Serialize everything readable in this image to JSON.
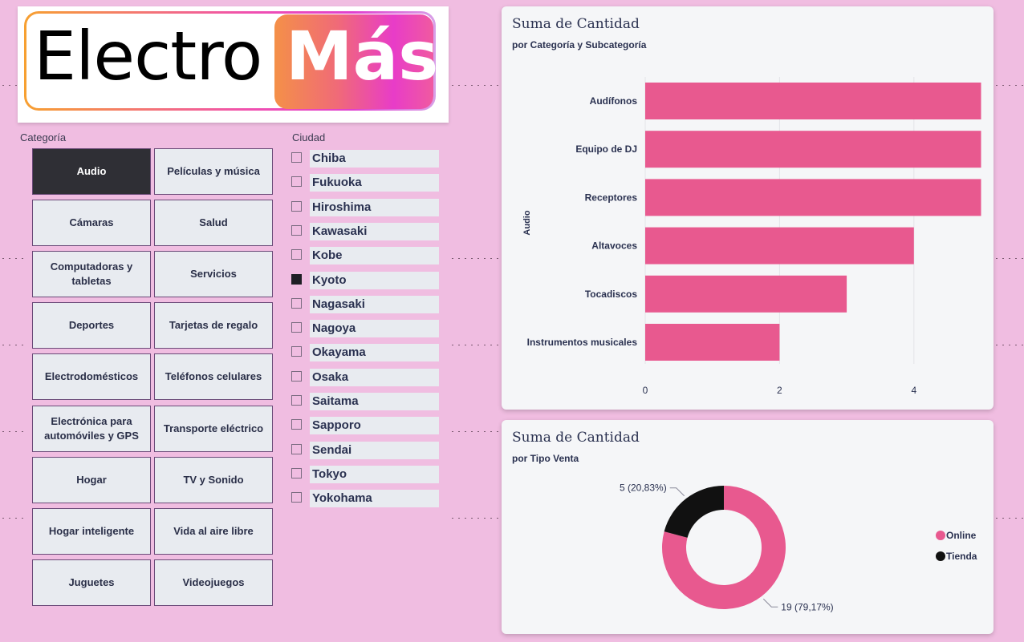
{
  "logo": {
    "part1": "Electro",
    "part2": "Más"
  },
  "category_slicer": {
    "title": "Categoría",
    "items": [
      {
        "label": "Audio",
        "selected": true
      },
      {
        "label": "Películas y música",
        "selected": false
      },
      {
        "label": "Cámaras",
        "selected": false
      },
      {
        "label": "Salud",
        "selected": false
      },
      {
        "label": "Computadoras y tabletas",
        "selected": false
      },
      {
        "label": "Servicios",
        "selected": false
      },
      {
        "label": "Deportes",
        "selected": false
      },
      {
        "label": "Tarjetas de regalo",
        "selected": false
      },
      {
        "label": "Electrodomésticos",
        "selected": false
      },
      {
        "label": "Teléfonos celulares",
        "selected": false
      },
      {
        "label": "Electrónica para automóviles y GPS",
        "selected": false
      },
      {
        "label": "Transporte eléctrico",
        "selected": false
      },
      {
        "label": "Hogar",
        "selected": false
      },
      {
        "label": "TV y Sonido",
        "selected": false
      },
      {
        "label": "Hogar inteligente",
        "selected": false
      },
      {
        "label": "Vida al aire libre",
        "selected": false
      },
      {
        "label": "Juguetes",
        "selected": false
      },
      {
        "label": "Videojuegos",
        "selected": false
      }
    ]
  },
  "city_slicer": {
    "title": "Ciudad",
    "items": [
      {
        "label": "Chiba",
        "checked": false
      },
      {
        "label": "Fukuoka",
        "checked": false
      },
      {
        "label": "Hiroshima",
        "checked": false
      },
      {
        "label": "Kawasaki",
        "checked": false
      },
      {
        "label": "Kobe",
        "checked": false
      },
      {
        "label": "Kyoto",
        "checked": true
      },
      {
        "label": "Nagasaki",
        "checked": false
      },
      {
        "label": "Nagoya",
        "checked": false
      },
      {
        "label": "Okayama",
        "checked": false
      },
      {
        "label": "Osaka",
        "checked": false
      },
      {
        "label": "Saitama",
        "checked": false
      },
      {
        "label": "Sapporo",
        "checked": false
      },
      {
        "label": "Sendai",
        "checked": false
      },
      {
        "label": "Tokyo",
        "checked": false
      },
      {
        "label": "Yokohama",
        "checked": false
      }
    ]
  },
  "colors": {
    "accent": "#e8598f",
    "dark": "#111111",
    "selected_button": "#2f2f35"
  },
  "chart_data": [
    {
      "type": "bar",
      "orientation": "horizontal",
      "title": "Suma de Cantidad",
      "subtitle": "por Categoría y Subcategoría",
      "group_label": "Audio",
      "categories": [
        "Audífonos",
        "Equipo de DJ",
        "Receptores",
        "Altavoces",
        "Tocadiscos",
        "Instrumentos musicales"
      ],
      "values": [
        5,
        5,
        5,
        4,
        3,
        2
      ],
      "x_ticks": [
        "0",
        "2",
        "4"
      ],
      "xlim": [
        0,
        5
      ],
      "grid": true,
      "color": "#e8598f"
    },
    {
      "type": "pie",
      "donut": true,
      "title": "Suma de Cantidad",
      "subtitle": "por Tipo Venta",
      "slices": [
        {
          "name": "Online",
          "value": 19,
          "label": "19 (79,17%)",
          "color": "#e8598f"
        },
        {
          "name": "Tienda",
          "value": 5,
          "label": "5 (20,83%)",
          "color": "#111111"
        }
      ],
      "legend_position": "right"
    }
  ]
}
